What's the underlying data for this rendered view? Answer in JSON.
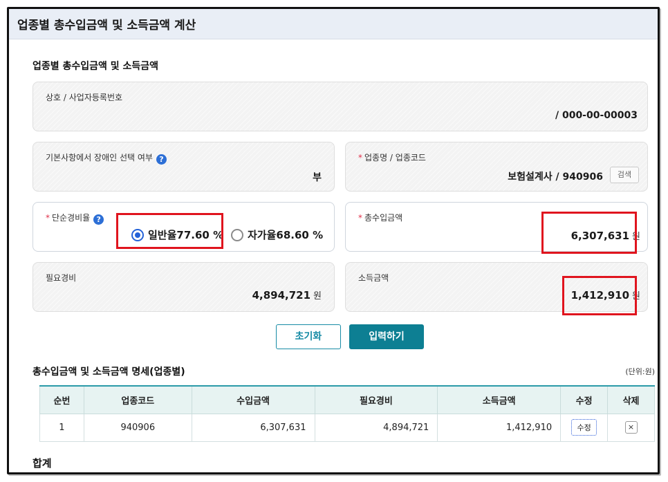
{
  "header": {
    "title": "업종별 총수입금액 및 소득금액 계산"
  },
  "section": {
    "title": "업종별 총수입금액 및 소득금액"
  },
  "business": {
    "label": "상호 / 사업자등록번호",
    "value": "/   000-00-00003"
  },
  "disabled": {
    "label": "기본사항에서 장애인 선택 여부",
    "help": "?",
    "value": "부"
  },
  "industry": {
    "required_mark": "*",
    "label": "업종명 / 업종코드",
    "value": "보험설계사  /   940906",
    "search_label": "검색"
  },
  "expense_rate": {
    "required_mark": "*",
    "label": "단순경비율",
    "help": "?",
    "options": [
      {
        "label": "일반율77.60 %",
        "selected": true
      },
      {
        "label": "자가율68.60 %",
        "selected": false
      }
    ]
  },
  "total_income": {
    "required_mark": "*",
    "label": "총수입금액",
    "value": "6,307,631",
    "unit": "원"
  },
  "required_expense": {
    "label": "필요경비",
    "value": "4,894,721",
    "unit": "원"
  },
  "income_amount": {
    "label": "소득금액",
    "value": "1,412,910",
    "unit": "원"
  },
  "buttons": {
    "reset": "초기화",
    "submit": "입력하기"
  },
  "detail": {
    "title": "총수입금액 및 소득금액 명세(업종별)",
    "unit_note": "(단위:원)",
    "columns": [
      "순번",
      "업종코드",
      "수입금액",
      "필요경비",
      "소득금액",
      "수정",
      "삭제"
    ],
    "rows": [
      {
        "no": "1",
        "code": "940906",
        "income": "6,307,631",
        "expense": "4,894,721",
        "net": "1,412,910",
        "edit": "수정",
        "delete": "×"
      }
    ]
  },
  "total": {
    "label": "합계"
  },
  "colors": {
    "accent": "#0d7f93",
    "highlight": "#e0141e",
    "radio": "#2462d8"
  }
}
